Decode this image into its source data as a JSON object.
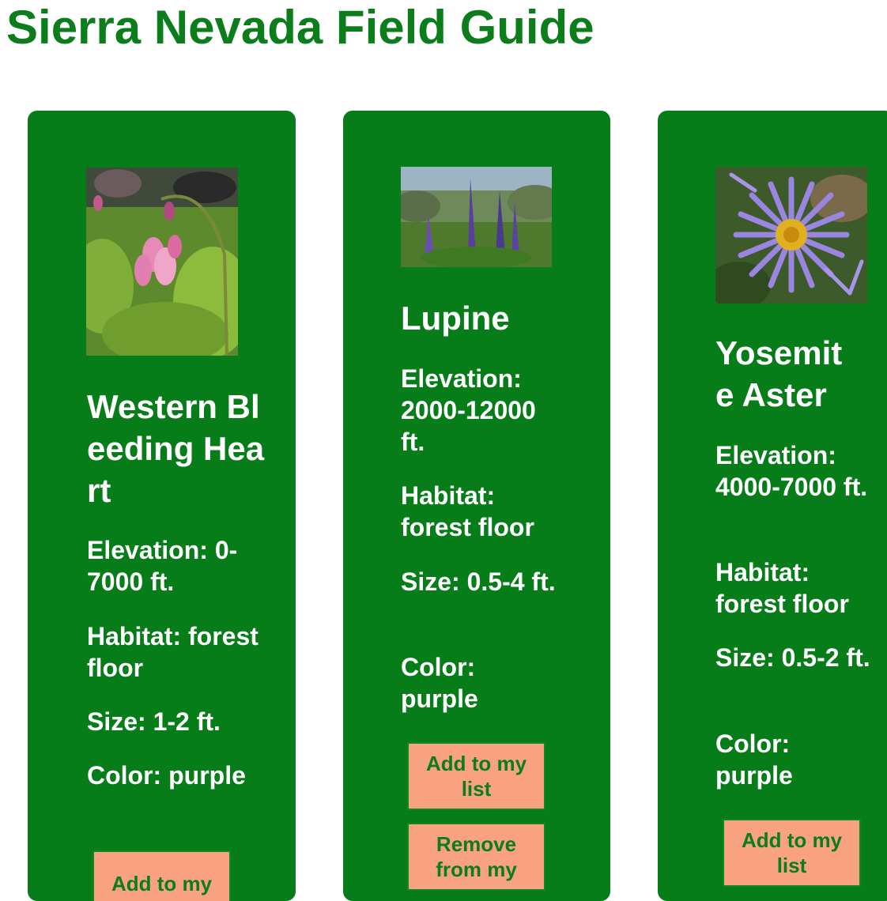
{
  "page": {
    "title": "Sierra Nevada Field Guide"
  },
  "colors": {
    "title_green": "#0b7d1b",
    "card_green": "#077d1a",
    "button_salmon": "#f9a282",
    "button_text": "#0b7d1b"
  },
  "cards": [
    {
      "name": "Western Bleeding Heart",
      "image_icon": "bleeding-heart-photo",
      "elevation": "Elevation: 0-7000 ft.",
      "habitat": "Habitat: forest floor",
      "size": "Size: 1-2 ft.",
      "color": "Color: purple",
      "add_label": "Add to my"
    },
    {
      "name": "Lupine",
      "image_icon": "lupine-photo",
      "elevation": "Elevation: 2000-12000 ft.",
      "habitat": "Habitat: forest floor",
      "size": "Size: 0.5-4 ft.",
      "color": "Color: purple",
      "add_label": "Add to my list",
      "remove_label": "Remove from my"
    },
    {
      "name": "Yosemite Aster",
      "image_icon": "aster-photo",
      "elevation": "Elevation: 4000-7000 ft.",
      "habitat": "Habitat: forest floor",
      "size": "Size: 0.5-2 ft.",
      "color": "Color: purple",
      "add_label": "Add to my list"
    }
  ]
}
